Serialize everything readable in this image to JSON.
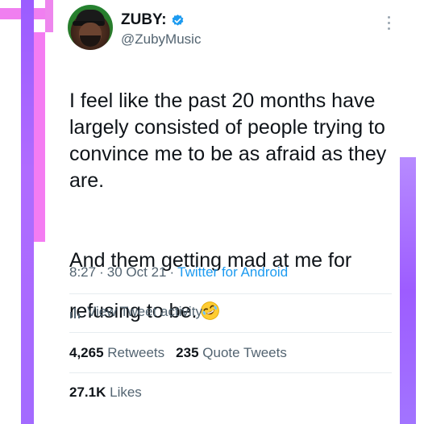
{
  "author": {
    "display_name": "ZUBY:",
    "handle": "@ZubyMusic",
    "verified": true
  },
  "tweet": {
    "paragraph_1": "I feel like the past 20 months have largely consisted of people trying to convince me to be as afraid as they are.",
    "paragraph_2": "And them getting mad at me for refusing to be.",
    "emoji": "rolling-on-floor-laughing-icon"
  },
  "meta": {
    "time": "8:27",
    "separator": "·",
    "date": "30 Oct 21",
    "source": "Twitter for Android"
  },
  "activity": {
    "label": "View Tweet activity"
  },
  "stats": {
    "retweets_count": "4,265",
    "retweets_label": "Retweets",
    "quote_count": "235",
    "quote_label": "Quote Tweets",
    "likes_count": "27.1K",
    "likes_label": "Likes"
  },
  "colors": {
    "accent_blue": "#1d9bf0",
    "text_primary": "#0f1419",
    "text_secondary": "#536471",
    "deco_purple": "#9b5cff",
    "deco_pink": "#f07ff0"
  }
}
